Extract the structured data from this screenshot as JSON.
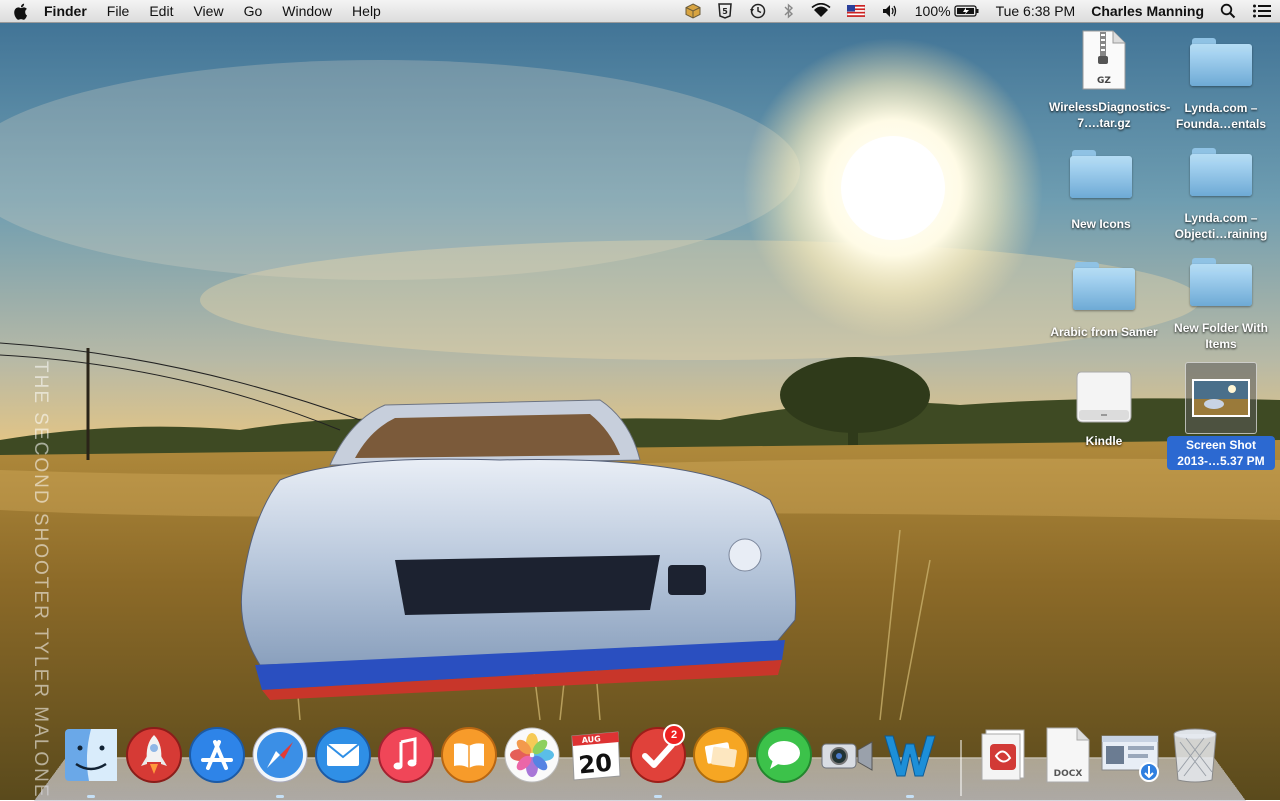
{
  "menubar": {
    "app_name": "Finder",
    "menus": [
      "File",
      "Edit",
      "View",
      "Go",
      "Window",
      "Help"
    ],
    "battery": "100%",
    "clock": "Tue 6:38 PM",
    "user": "Charles Manning"
  },
  "wallpaper": {
    "watermark": "THE SECOND SHOOTER TYLER MALONE"
  },
  "desktop_icons": [
    {
      "label": "WirelessDiagnostics-7….tar.gz",
      "icon": "gz-archive-icon",
      "badge": "GZ"
    },
    {
      "label": "Lynda.com – Founda…entals",
      "icon": "folder-icon"
    },
    {
      "label": "New Icons",
      "icon": "folder-icon"
    },
    {
      "label": "Lynda.com – Objecti…raining",
      "icon": "folder-icon"
    },
    {
      "label": "Arabic from Samer",
      "icon": "folder-icon"
    },
    {
      "label": "New Folder With Items",
      "icon": "folder-icon"
    },
    {
      "label": "Kindle",
      "icon": "drive-icon"
    },
    {
      "label": "Screen Shot 2013-…5.37 PM",
      "icon": "screenshot-file-icon"
    }
  ],
  "dock": {
    "apps": [
      "Finder",
      "Launchpad",
      "App Store",
      "Safari",
      "Mail",
      "iTunes",
      "iBooks",
      "Photos",
      "Calendar",
      "Wunderlist",
      "Keynote",
      "Messages",
      "FaceTime",
      "Word"
    ],
    "calendar_month": "AUG",
    "calendar_day": "20",
    "wunderlist_badge": "2",
    "docx_label": "DOCX"
  }
}
